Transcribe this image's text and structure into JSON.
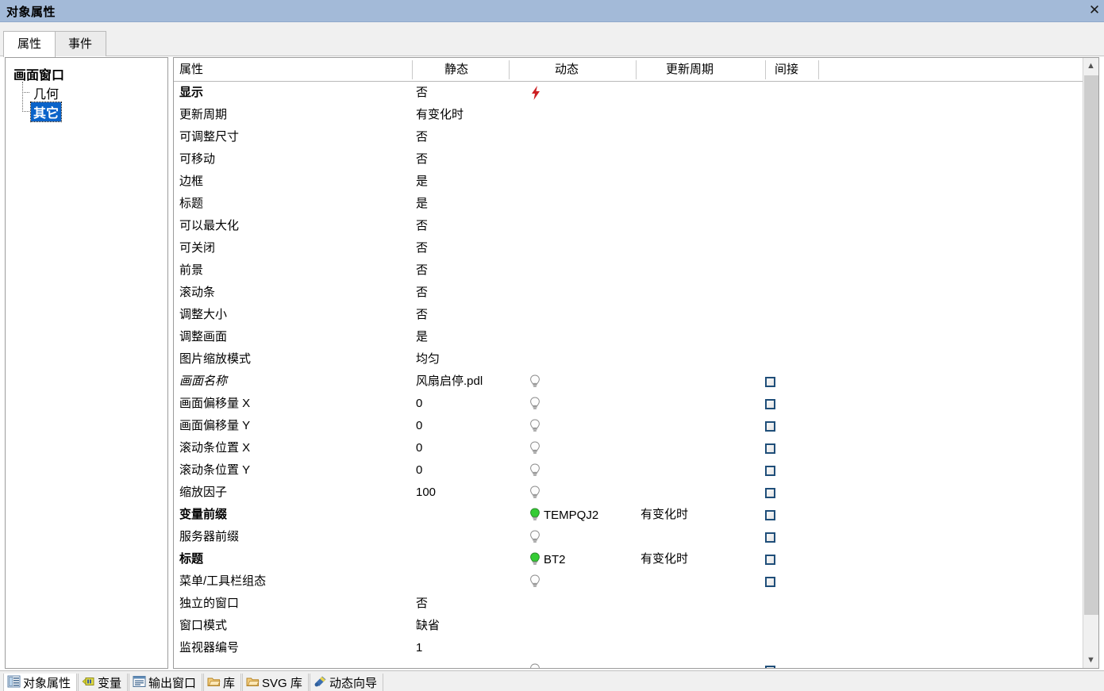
{
  "window": {
    "title": "对象属性",
    "close_icon": "close-icon"
  },
  "tabs": [
    {
      "label": "属性",
      "active": true
    },
    {
      "label": "事件",
      "active": false
    }
  ],
  "tree": {
    "root": "画面窗口",
    "children": [
      {
        "label": "几何",
        "selected": false
      },
      {
        "label": "其它",
        "selected": true
      }
    ]
  },
  "grid": {
    "columns": [
      "属性",
      "静态",
      "动态",
      "更新周期",
      "间接"
    ],
    "rows": [
      {
        "name": "显示",
        "bold": true,
        "static": "否",
        "dynamic": "",
        "icon": "bolt",
        "period": "",
        "indirect": false
      },
      {
        "name": "更新周期",
        "bold": false,
        "static": "有变化时",
        "dynamic": "",
        "icon": "",
        "period": "",
        "indirect": false
      },
      {
        "name": "可调整尺寸",
        "bold": false,
        "static": "否",
        "dynamic": "",
        "icon": "",
        "period": "",
        "indirect": false
      },
      {
        "name": "可移动",
        "bold": false,
        "static": "否",
        "dynamic": "",
        "icon": "",
        "period": "",
        "indirect": false
      },
      {
        "name": "边框",
        "bold": false,
        "static": "是",
        "dynamic": "",
        "icon": "",
        "period": "",
        "indirect": false
      },
      {
        "name": "标题",
        "bold": false,
        "static": "是",
        "dynamic": "",
        "icon": "",
        "period": "",
        "indirect": false
      },
      {
        "name": "可以最大化",
        "bold": false,
        "static": "否",
        "dynamic": "",
        "icon": "",
        "period": "",
        "indirect": false
      },
      {
        "name": "可关闭",
        "bold": false,
        "static": "否",
        "dynamic": "",
        "icon": "",
        "period": "",
        "indirect": false
      },
      {
        "name": "前景",
        "bold": false,
        "static": "否",
        "dynamic": "",
        "icon": "",
        "period": "",
        "indirect": false
      },
      {
        "name": "滚动条",
        "bold": false,
        "static": "否",
        "dynamic": "",
        "icon": "",
        "period": "",
        "indirect": false
      },
      {
        "name": "调整大小",
        "bold": false,
        "static": "否",
        "dynamic": "",
        "icon": "",
        "period": "",
        "indirect": false
      },
      {
        "name": "调整画面",
        "bold": false,
        "static": "是",
        "dynamic": "",
        "icon": "",
        "period": "",
        "indirect": false
      },
      {
        "name": "图片缩放模式",
        "bold": false,
        "static": "均匀",
        "dynamic": "",
        "icon": "",
        "period": "",
        "indirect": false
      },
      {
        "name": "画面名称",
        "italic": true,
        "static": "风扇启停.pdl",
        "dynamic": "",
        "icon": "bulb-gray",
        "period": "",
        "indirect": true
      },
      {
        "name": "画面偏移量 X",
        "static": "0",
        "dynamic": "",
        "icon": "bulb-gray",
        "period": "",
        "indirect": true
      },
      {
        "name": "画面偏移量 Y",
        "static": "0",
        "dynamic": "",
        "icon": "bulb-gray",
        "period": "",
        "indirect": true
      },
      {
        "name": "滚动条位置 X",
        "static": "0",
        "dynamic": "",
        "icon": "bulb-gray",
        "period": "",
        "indirect": true
      },
      {
        "name": "滚动条位置 Y",
        "static": "0",
        "dynamic": "",
        "icon": "bulb-gray",
        "period": "",
        "indirect": true
      },
      {
        "name": "缩放因子",
        "static": "100",
        "dynamic": "",
        "icon": "bulb-gray",
        "period": "",
        "indirect": true
      },
      {
        "name": "变量前缀",
        "bold": true,
        "static": "",
        "dynamic": "TEMPQJ2",
        "icon": "bulb-green",
        "period": "有变化时",
        "indirect": true
      },
      {
        "name": "服务器前缀",
        "static": "",
        "dynamic": "",
        "icon": "bulb-gray",
        "period": "",
        "indirect": true
      },
      {
        "name": "标题",
        "bold": true,
        "static": "",
        "dynamic": "BT2",
        "icon": "bulb-green",
        "period": "有变化时",
        "indirect": true
      },
      {
        "name": "菜单/工具栏组态",
        "static": "",
        "dynamic": "",
        "icon": "bulb-gray",
        "period": "",
        "indirect": true
      },
      {
        "name": "独立的窗口",
        "static": "否",
        "dynamic": "",
        "icon": "",
        "period": "",
        "indirect": false
      },
      {
        "name": "窗口模式",
        "static": "缺省",
        "dynamic": "",
        "icon": "",
        "period": "",
        "indirect": false
      },
      {
        "name": "监视器编号",
        "static": "1",
        "dynamic": "",
        "icon": "",
        "period": "",
        "indirect": false
      },
      {
        "name": "",
        "static": "",
        "dynamic": "",
        "icon": "bulb-gray",
        "period": "",
        "indirect": true
      }
    ]
  },
  "scrollbar": {
    "up_icon": "chevron-up-icon",
    "down_icon": "chevron-down-icon"
  },
  "taskbar": {
    "items": [
      {
        "label": "对象属性",
        "icon": "object-properties-icon",
        "active": true
      },
      {
        "label": "变量",
        "icon": "variable-icon",
        "active": false
      },
      {
        "label": "输出窗口",
        "icon": "output-window-icon",
        "active": false
      },
      {
        "label": "库",
        "icon": "library-icon",
        "active": false
      },
      {
        "label": "SVG 库",
        "icon": "svg-library-icon",
        "active": false
      },
      {
        "label": "动态向导",
        "icon": "dynamic-wizard-icon",
        "active": false
      }
    ]
  },
  "colors": {
    "titlebar": "#a3bad8",
    "selection": "#0a63c9",
    "bolt": "#cc1f22",
    "bulb_on": "#33cc33",
    "checkbox_border": "#1f4e79"
  }
}
